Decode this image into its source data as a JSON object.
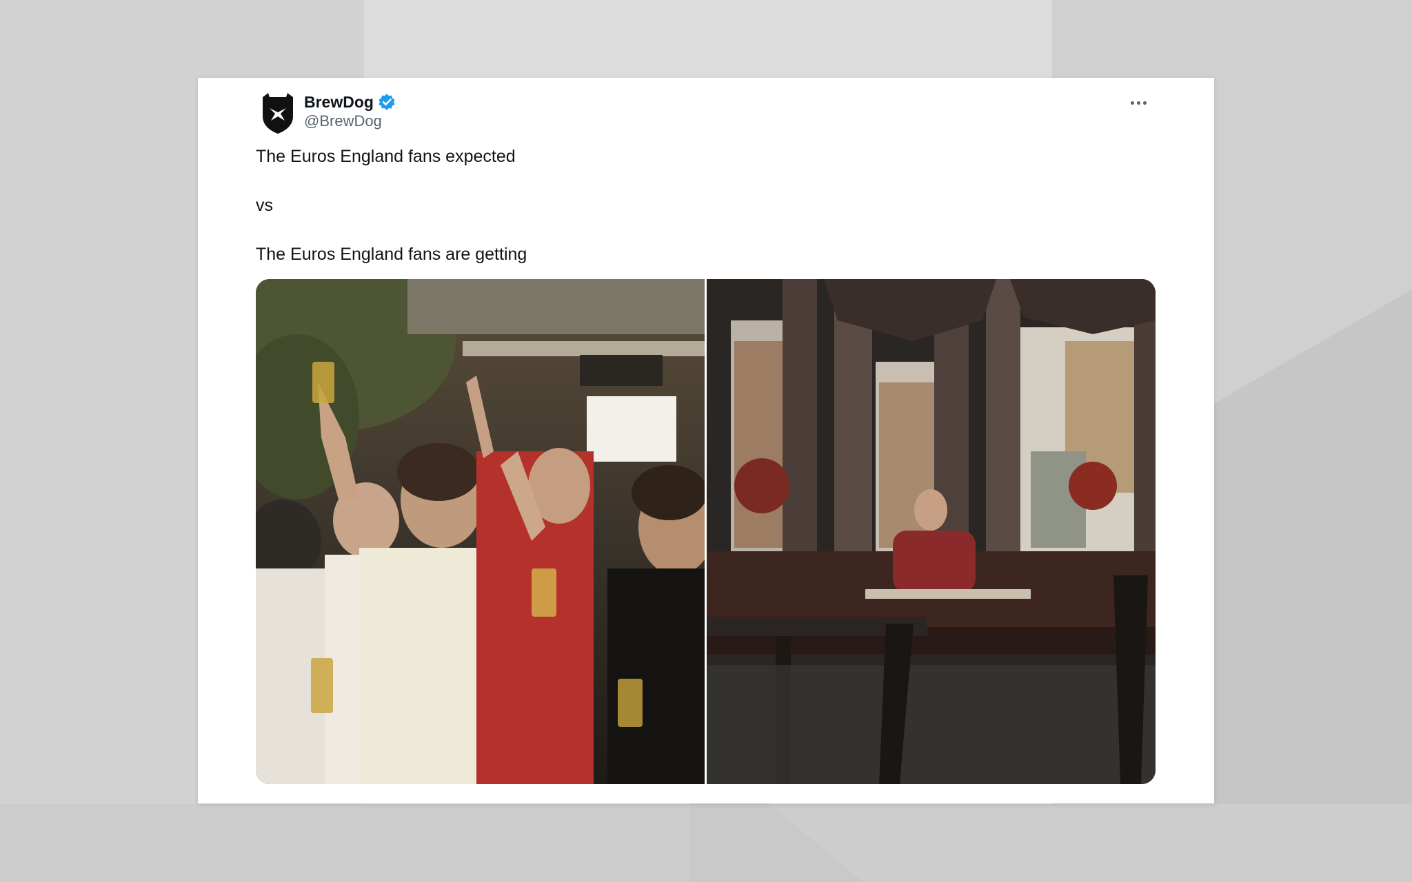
{
  "tweet": {
    "author": {
      "name": "BrewDog",
      "handle": "@BrewDog",
      "verified": true,
      "avatar_icon": "brewdog-shield-logo"
    },
    "text_lines": [
      "The Euros England fans expected",
      "vs",
      "The Euros England fans are getting"
    ],
    "media": [
      {
        "alt": "photo of cheering England fans in a crowded bar"
      },
      {
        "alt": "photo of a lone England fan sitting at an empty pub table"
      }
    ],
    "more_icon": "more-options-icon"
  },
  "colors": {
    "verified_blue": "#1d9bf0",
    "text": "#0f1419",
    "secondary": "#536471"
  }
}
